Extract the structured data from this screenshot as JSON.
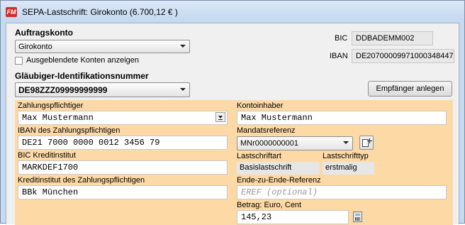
{
  "window": {
    "title": "SEPA-Lastschrift: Girokonto (6.700,12 € )",
    "app_icon": "FM"
  },
  "auftragskonto": {
    "label": "Auftragskonto",
    "selected": "Girokonto",
    "show_hidden_label": "Ausgeblendete Konten anzeigen",
    "bic_label": "BIC",
    "bic_value": "DDBADEMM002",
    "iban_label": "IBAN",
    "iban_value": "DE20700009971000348447"
  },
  "glaeubiger": {
    "label": "Gläubiger-Identifikationsnummer",
    "selected": "DE98ZZZ09999999999",
    "button_label": "Empfänger anlegen"
  },
  "form": {
    "zahlungspflichtiger_label": "Zahlungspflichtiger",
    "zahlungspflichtiger_value": "Max Mustermann",
    "iban_label": "IBAN des Zahlungspflichtigen",
    "iban_value": "DE21 7000 0000 0012 3456 79",
    "bic_label": "BIC Kreditinstitut",
    "bic_value": "MARKDEF1700",
    "kreditinstitut_label": "Kreditinstitut des Zahlungspflichtigen",
    "kreditinstitut_value": "BBk München",
    "kontoinhaber_label": "Kontoinhaber",
    "kontoinhaber_value": "Max Mustermann",
    "mandatsreferenz_label": "Mandatsreferenz",
    "mandatsreferenz_value": "MNr0000000001",
    "lastschriftart_label": "Lastschriftart",
    "lastschriftart_value": "Basislastschrift",
    "lastschrifttyp_label": "Lastschrifttyp",
    "lastschrifttyp_value": "erstmalig",
    "e2e_label": "Ende-zu-Ende-Referenz",
    "e2e_placeholder": "EREF (optional)",
    "betrag_label": "Betrag: Euro, Cent",
    "betrag_value": "145,23"
  }
}
